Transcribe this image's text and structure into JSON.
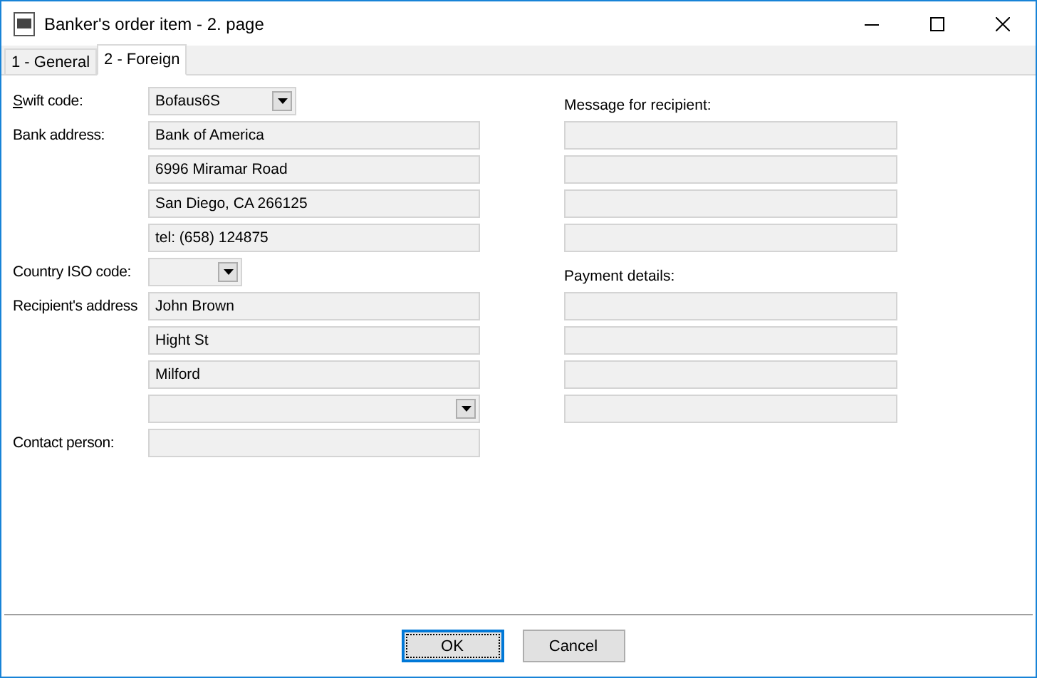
{
  "window": {
    "title": "Banker's order item - 2. page"
  },
  "tabs": [
    {
      "label": "1 - General",
      "selected": false
    },
    {
      "label": "2 - Foreign",
      "selected": true
    }
  ],
  "left_rows": [
    {
      "label": "Swift code:",
      "accesskey": true,
      "kind": "short-combo",
      "value": "Bofaus6S"
    },
    {
      "label": "Bank address:",
      "kind": "text",
      "value": "Bank of America"
    },
    {
      "kind": "text",
      "value": "6996 Miramar Road"
    },
    {
      "kind": "text",
      "value": "San Diego, CA 266125"
    },
    {
      "kind": "text",
      "value": "tel: (658) 124875"
    },
    {
      "label": "Country ISO code:",
      "kind": "tiny-combo"
    },
    {
      "label": "Recipient's address",
      "kind": "text",
      "value": "John Brown"
    },
    {
      "kind": "text",
      "value": "Hight St"
    },
    {
      "kind": "text",
      "value": "Milford"
    },
    {
      "kind": "combo"
    },
    {
      "label": "Contact person:",
      "kind": "text"
    }
  ],
  "right_rows": [
    {
      "kind": "label",
      "label": "Message for recipient:"
    },
    {
      "kind": "text"
    },
    {
      "kind": "text"
    },
    {
      "kind": "text"
    },
    {
      "kind": "text"
    },
    {
      "kind": "label",
      "label": "Payment details:"
    },
    {
      "kind": "text"
    },
    {
      "kind": "text"
    },
    {
      "kind": "text"
    },
    {
      "kind": "text"
    }
  ],
  "buttons": [
    {
      "label": "OK",
      "focused": true
    },
    {
      "label": "Cancel",
      "focused": false
    }
  ]
}
